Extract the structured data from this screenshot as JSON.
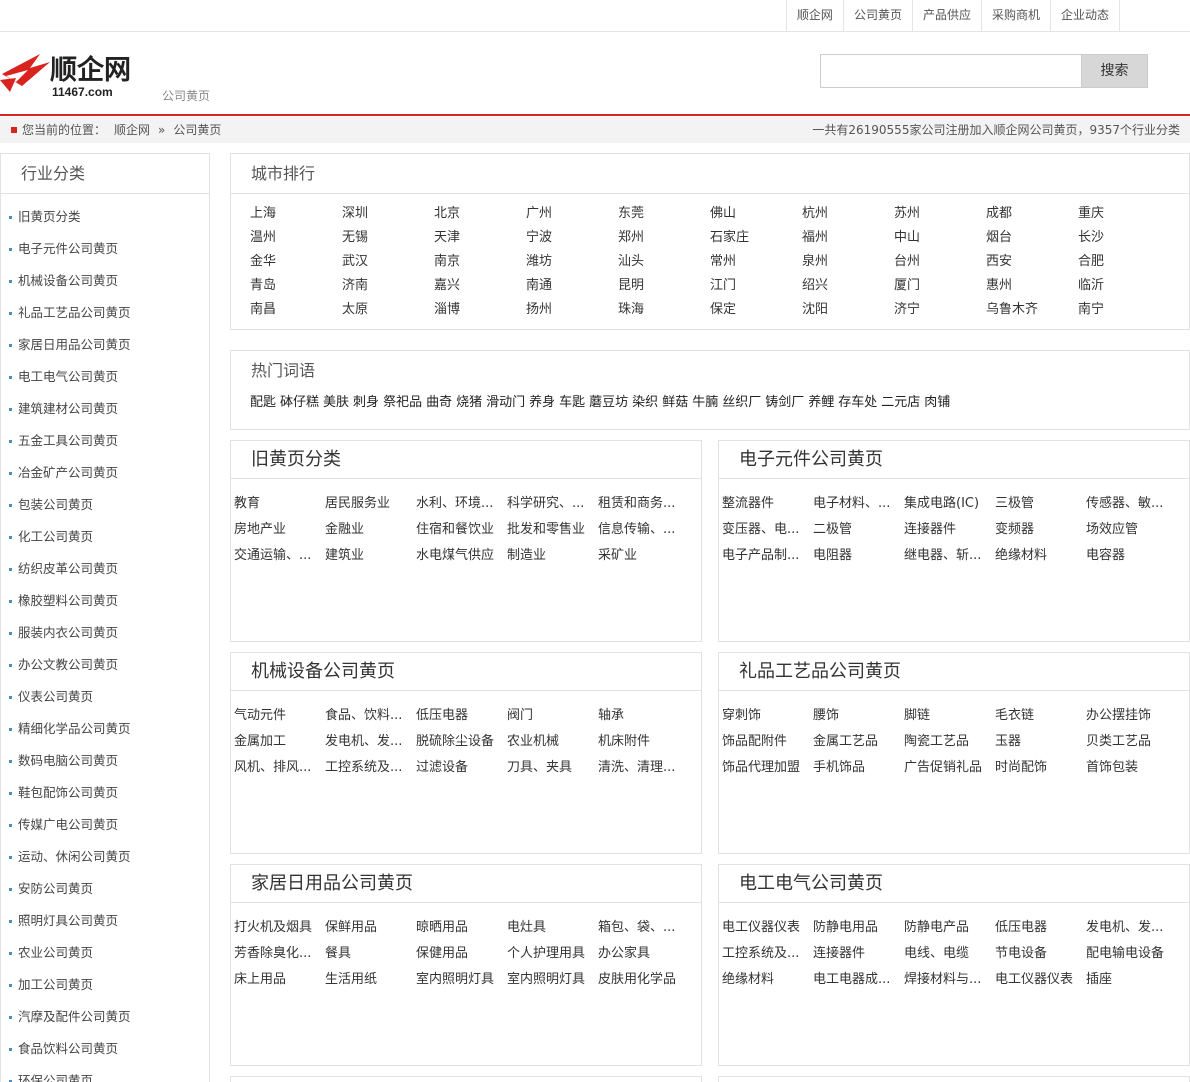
{
  "topnav": [
    "顺企网",
    "公司黄页",
    "产品供应",
    "采购商机",
    "企业动态"
  ],
  "logo": {
    "text": "顺企网",
    "domain": "11467.com",
    "sub": "公司黄页"
  },
  "search": {
    "placeholder": "",
    "button": "搜索"
  },
  "breadcrumb": {
    "prefix": "您当前的位置：",
    "items": [
      "顺企网",
      "»",
      "公司黄页"
    ],
    "stats": "一共有26190555家公司注册加入顺企网公司黄页，9357个行业分类"
  },
  "sidebar": {
    "title": "行业分类",
    "items": [
      "旧黄页分类",
      "电子元件公司黄页",
      "机械设备公司黄页",
      "礼品工艺品公司黄页",
      "家居日用品公司黄页",
      "电工电气公司黄页",
      "建筑建材公司黄页",
      "五金工具公司黄页",
      "冶金矿产公司黄页",
      "包装公司黄页",
      "化工公司黄页",
      "纺织皮革公司黄页",
      "橡胶塑料公司黄页",
      "服装内衣公司黄页",
      "办公文教公司黄页",
      "仪表公司黄页",
      "精细化学品公司黄页",
      "数码电脑公司黄页",
      "鞋包配饰公司黄页",
      "传媒广电公司黄页",
      "运动、休闲公司黄页",
      "安防公司黄页",
      "照明灯具公司黄页",
      "农业公司黄页",
      "加工公司黄页",
      "汽摩及配件公司黄页",
      "食品饮料公司黄页",
      "环保公司黄页"
    ]
  },
  "cities": {
    "title": "城市排行",
    "items": [
      "上海",
      "深圳",
      "北京",
      "广州",
      "东莞",
      "佛山",
      "杭州",
      "苏州",
      "成都",
      "重庆",
      "温州",
      "无锡",
      "天津",
      "宁波",
      "郑州",
      "石家庄",
      "福州",
      "中山",
      "烟台",
      "长沙",
      "金华",
      "武汉",
      "南京",
      "潍坊",
      "汕头",
      "常州",
      "泉州",
      "台州",
      "西安",
      "合肥",
      "青岛",
      "济南",
      "嘉兴",
      "南通",
      "昆明",
      "江门",
      "绍兴",
      "厦门",
      "惠州",
      "临沂",
      "南昌",
      "太原",
      "淄博",
      "扬州",
      "珠海",
      "保定",
      "沈阳",
      "济宁",
      "乌鲁木齐",
      "南宁"
    ]
  },
  "hot": {
    "title": "热门词语",
    "items": [
      "配匙",
      "砵仔糕",
      "美肤",
      "刺身",
      "祭祀品",
      "曲奇",
      "烧猪",
      "滑动门",
      "养身",
      "车匙",
      "蘑豆坊",
      "染织",
      "鲜菇",
      "牛腩",
      "丝织厂",
      "铸剑厂",
      "养鲤",
      "存车处",
      "二元店",
      "肉铺"
    ]
  },
  "categories": [
    {
      "title": "旧黄页分类",
      "items": [
        "教育",
        "居民服务业",
        "水利、环境...",
        "科学研究、...",
        "租赁和商务...",
        "房地产业",
        "金融业",
        "住宿和餐饮业",
        "批发和零售业",
        "信息传输、...",
        "交通运输、...",
        "建筑业",
        "水电煤气供应",
        "制造业",
        "采矿业"
      ]
    },
    {
      "title": "电子元件公司黄页",
      "items": [
        "整流器件",
        "电子材料、...",
        "集成电路(IC)",
        "三极管",
        "传感器、敏...",
        "变压器、电...",
        "二极管",
        "连接器件",
        "变频器",
        "场效应管",
        "电子产品制...",
        "电阻器",
        "继电器、斩...",
        "绝缘材料",
        "电容器"
      ]
    },
    {
      "title": "机械设备公司黄页",
      "items": [
        "气动元件",
        "食品、饮料...",
        "低压电器",
        "阀门",
        "轴承",
        "金属加工",
        "发电机、发...",
        "脱硫除尘设备",
        "农业机械",
        "机床附件",
        "风机、排风...",
        "工控系统及...",
        "过滤设备",
        "刀具、夹具",
        "清洗、清理..."
      ]
    },
    {
      "title": "礼品工艺品公司黄页",
      "items": [
        "穿刺饰",
        "腰饰",
        "脚链",
        "毛衣链",
        "办公摆挂饰",
        "饰品配附件",
        "金属工艺品",
        "陶瓷工艺品",
        "玉器",
        "贝类工艺品",
        "饰品代理加盟",
        "手机饰品",
        "广告促销礼品",
        "时尚配饰",
        "首饰包装"
      ]
    },
    {
      "title": "家居日用品公司黄页",
      "items": [
        "打火机及烟具",
        "保鲜用品",
        "晾晒用品",
        "电灶具",
        "箱包、袋、...",
        "芳香除臭化...",
        "餐具",
        "保健用品",
        "个人护理用具",
        "办公家具",
        "床上用品",
        "生活用纸",
        "室内照明灯具",
        "室内照明灯具",
        "皮肤用化学品"
      ]
    },
    {
      "title": "电工电气公司黄页",
      "items": [
        "电工仪器仪表",
        "防静电用品",
        "防静电产品",
        "低压电器",
        "发电机、发...",
        "工控系统及...",
        "连接器件",
        "电线、电缆",
        "节电设备",
        "配电输电设备",
        "绝缘材料",
        "电工电器成...",
        "焊接材料与...",
        "电工仪器仪表",
        "插座"
      ]
    }
  ]
}
